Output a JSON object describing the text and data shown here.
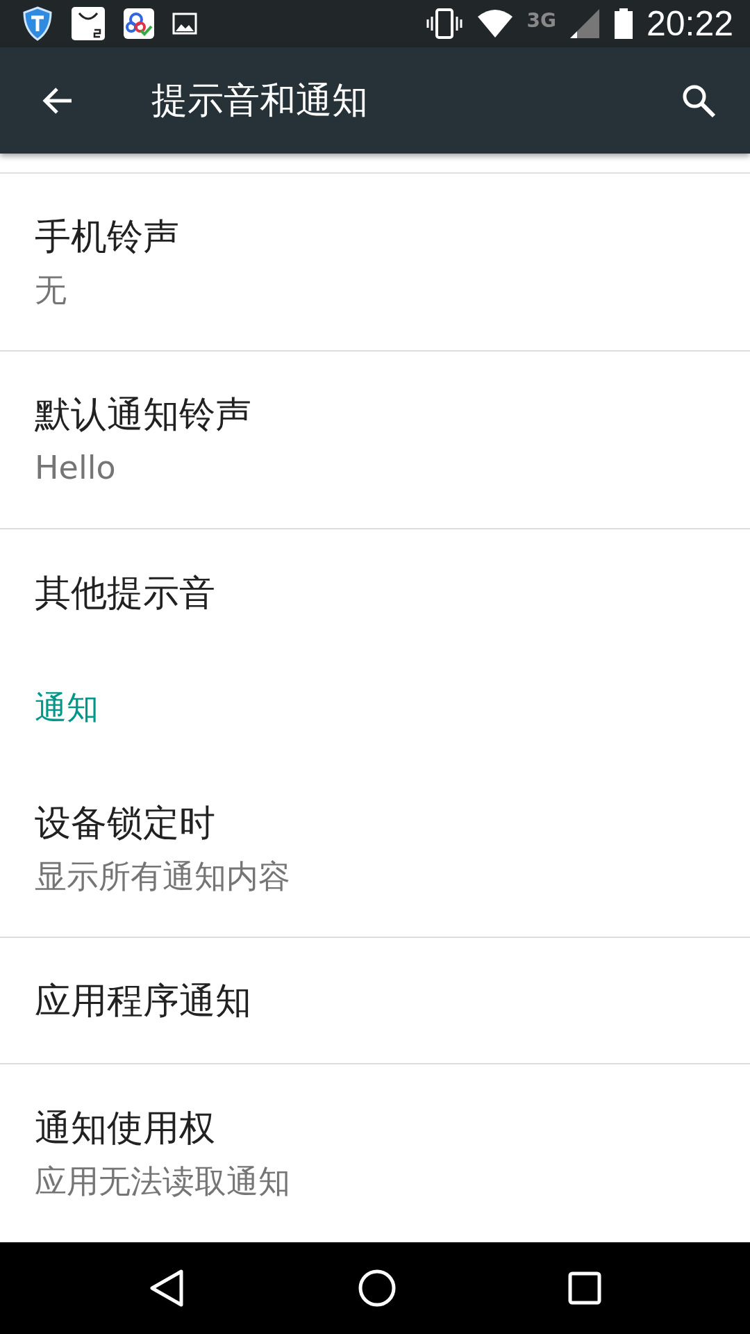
{
  "status_bar": {
    "network": "3G",
    "time": "20:22"
  },
  "app_bar": {
    "title": "提示音和通知"
  },
  "list": [
    {
      "kind": "item",
      "title": "手机铃声",
      "subtitle": "无",
      "divider": true
    },
    {
      "kind": "item",
      "title": "默认通知铃声",
      "subtitle": "Hello",
      "divider": true
    },
    {
      "kind": "item",
      "title": "其他提示音",
      "divider": false
    },
    {
      "kind": "header",
      "title": "通知"
    },
    {
      "kind": "item",
      "title": "设备锁定时",
      "subtitle": "显示所有通知内容",
      "divider": true
    },
    {
      "kind": "item",
      "title": "应用程序通知",
      "divider": true
    },
    {
      "kind": "item",
      "title": "通知使用权",
      "subtitle": "应用无法读取通知",
      "divider": false
    }
  ]
}
